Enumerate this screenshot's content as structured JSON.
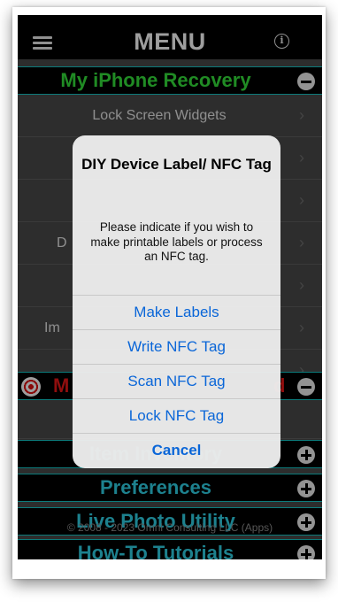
{
  "nav": {
    "title": "MENU"
  },
  "sections": {
    "recovery": {
      "label": "My iPhone Recovery",
      "color": "#34e03a",
      "state": "expanded"
    },
    "lost_mode": {
      "label_start": "M",
      "label_end": "d",
      "color": "#e81818",
      "state": "expanded"
    },
    "inventory": {
      "label": "Item Inventory",
      "color": "#2fd0e6",
      "state": "collapsed"
    },
    "preferences": {
      "label": "Preferences",
      "color": "#2fd0e6",
      "state": "collapsed"
    },
    "live_photo": {
      "label": "Live Photo Utility",
      "color": "#2fd0e6",
      "state": "collapsed"
    },
    "tutorials": {
      "label": "How-To Tutorials",
      "color": "#2fd0e6",
      "state": "collapsed"
    }
  },
  "rows": {
    "lock_screen_widgets": "Lock Screen Widgets",
    "partial_d": "D",
    "partial_im": "Im"
  },
  "footer": {
    "copyright": "© 2008 - 2023 Omni Consulting LLC (Apps)"
  },
  "dialog": {
    "title": "DIY Device Label/ NFC Tag",
    "message": "Please indicate if you wish to make printable labels or process an NFC tag.",
    "buttons": [
      "Make Labels",
      "Write NFC Tag",
      "Scan NFC Tag",
      "Lock NFC Tag"
    ],
    "cancel": "Cancel",
    "accent_color": "#0a66d8"
  }
}
